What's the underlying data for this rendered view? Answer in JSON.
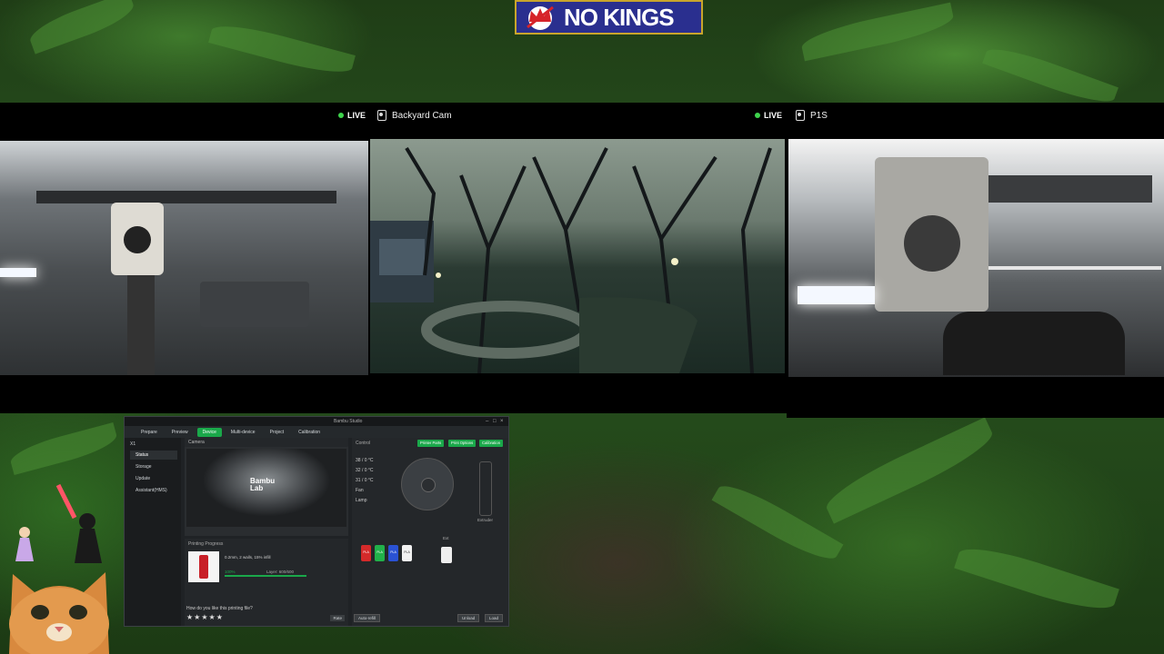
{
  "banner": {
    "text": "NO KINGS"
  },
  "cameras": [
    {
      "id": "cam1",
      "name": "",
      "live_label": "LIVE"
    },
    {
      "id": "cam2",
      "name": "Backyard Cam",
      "live_label": "LIVE"
    },
    {
      "id": "cam3",
      "name": "P1S",
      "live_label": ""
    }
  ],
  "bambu": {
    "window_title": "Bambu Studio",
    "tabs": [
      "Prepare",
      "Preview",
      "Device",
      "Multi-device",
      "Project",
      "Calibration"
    ],
    "active_tab": "Device",
    "printer": "X1",
    "sidebar": [
      "Status",
      "Storage",
      "Update",
      "Assistant(HMS)"
    ],
    "camera_header": "Camera",
    "logo": [
      "Bambu",
      "Lab"
    ],
    "progress_header": "Printing Progress",
    "file_info": "0.2mm, 2 walls, 15% infill",
    "percent": "100%",
    "layer": "Layer: 600/600",
    "progress_value": 1.0,
    "question": "How do you like this printing file?",
    "stars": "★★★★★",
    "rate_button": "Rate",
    "control_header": "Control",
    "control_buttons": [
      "Printer Parts",
      "Print Options",
      "Calibration"
    ],
    "temps": [
      "38 / 0 °C",
      "32 / 0 °C",
      "31 / 0 °C"
    ],
    "fan_label": "Fan",
    "lamp_label": "Lamp",
    "extruder_label": "Extruder",
    "ext_label": "Ext",
    "spools": [
      {
        "label": "PLA",
        "color": "#d42a2a"
      },
      {
        "label": "PLA",
        "color": "#21b14a"
      },
      {
        "label": "PLA",
        "color": "#2a52d4"
      },
      {
        "label": "PLA",
        "color": "#f2f2f2"
      }
    ],
    "auto_refill": "Auto-refill",
    "unload": "Unload",
    "load": "Load"
  },
  "colors": {
    "accent": "#1aa84a",
    "live_dot": "#3ed34c",
    "banner_bg": "#2a2f8f"
  }
}
